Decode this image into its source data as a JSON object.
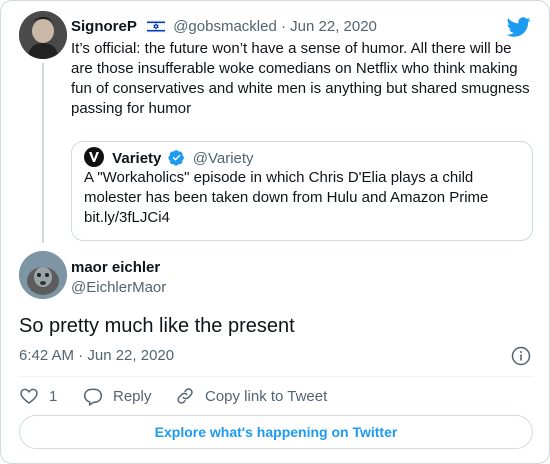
{
  "parent_tweet": {
    "author_name": "SignoreP",
    "author_handle": "@gobsmackled",
    "date": "Jun 22, 2020",
    "text": "It’s official: the future won’t have a sense of humor. All there will be are those insufferable woke comedians on Netflix who think making fun of conservatives and white men is anything but shared smugness passing for humor"
  },
  "quoted_tweet": {
    "author_name": "Variety",
    "author_handle": "@Variety",
    "text": "A \"Workaholics\" episode in which Chris D'Elia plays a child molester has been taken down from Hulu and Amazon Prime bit.ly/3fLJCi4"
  },
  "main_tweet": {
    "author_name": "maor eichler",
    "author_handle": "@EichlerMaor",
    "text": "So pretty much like the present",
    "timestamp": "6:42 AM · Jun 22, 2020"
  },
  "actions": {
    "like_count": "1",
    "reply_label": "Reply",
    "copy_label": "Copy link to Tweet"
  },
  "explore_label": "Explore what's happening on Twitter",
  "colors": {
    "twitter_blue": "#1d9bf0",
    "secondary_text": "#536471",
    "border": "#cfd9de"
  },
  "icons": [
    "israel-flag-icon",
    "twitter-bird-icon",
    "verified-badge-icon",
    "info-icon",
    "heart-icon",
    "reply-bubble-icon",
    "link-icon"
  ]
}
